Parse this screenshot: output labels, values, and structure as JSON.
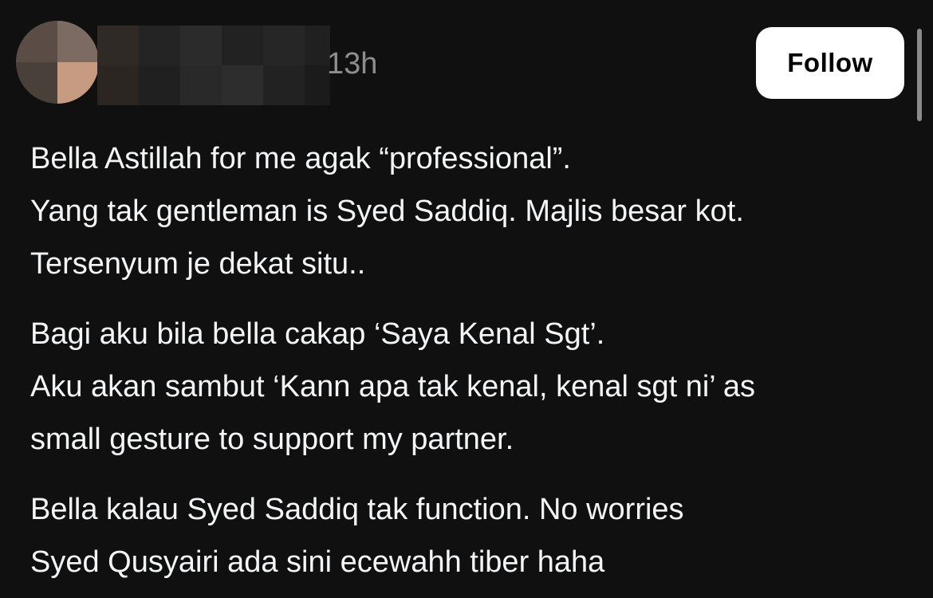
{
  "post": {
    "timestamp": "13h",
    "follow_label": "Follow",
    "paragraphs": [
      {
        "lines": [
          "Bella Astillah for me agak “professional”.",
          "Yang tak gentleman is Syed Saddiq. Majlis besar kot.",
          "Tersenyum je dekat situ.."
        ]
      },
      {
        "lines": [
          "Bagi aku bila bella cakap ‘Saya Kenal Sgt’.",
          "Aku akan sambut ‘Kann apa tak kenal, kenal sgt ni’ as",
          "small gesture to support my partner."
        ]
      },
      {
        "lines": [
          "Bella kalau Syed Saddiq tak function. No worries",
          "Syed Qusyairi ada sini ecewahh tiber haha"
        ]
      }
    ]
  },
  "colors": {
    "background": "#101010",
    "text": "#f3f5f7",
    "muted_text": "#8e8e8e",
    "button": "#ffffff",
    "button_text": "#000000"
  },
  "redaction": {
    "avatar": "blurred-profile-photo",
    "username": "pixelated-username"
  }
}
